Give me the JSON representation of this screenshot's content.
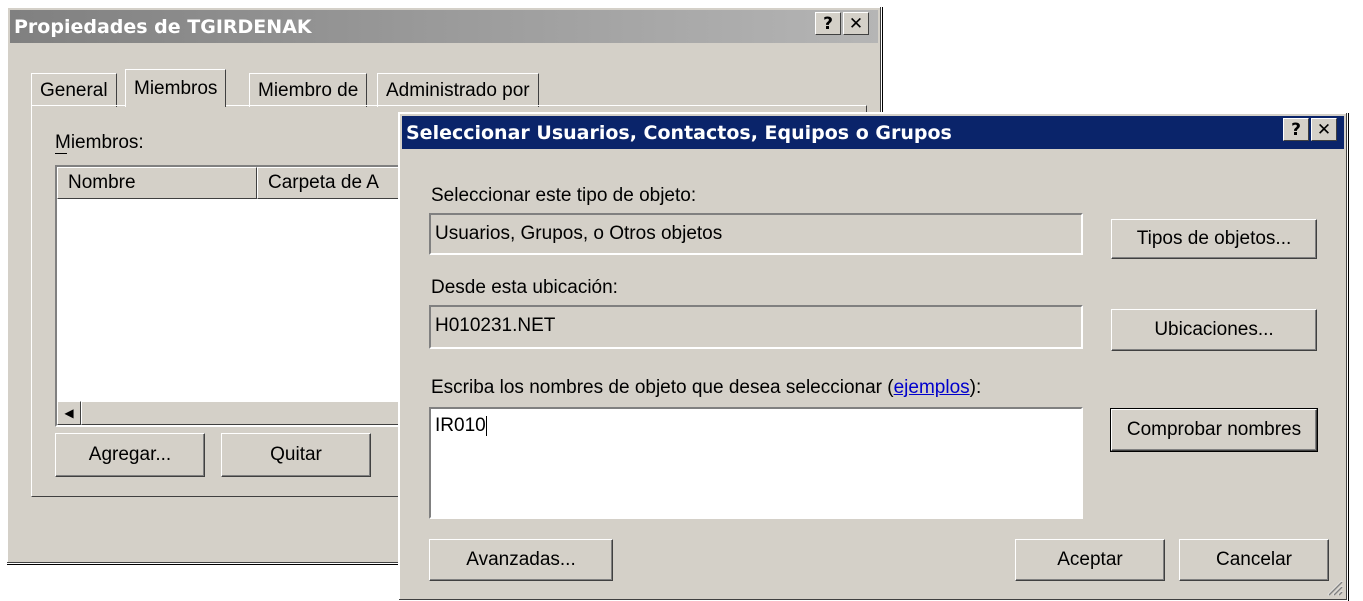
{
  "back_dialog": {
    "title": "Propiedades de TGIRDENAK",
    "help_glyph": "?",
    "close_glyph": "✕",
    "tabs": [
      "General",
      "Miembros",
      "Miembro de",
      "Administrado por"
    ],
    "members_label": "Miembros:",
    "columns": [
      "Nombre",
      "Carpeta de A"
    ],
    "scroll_left_glyph": "◀",
    "add_button": "Agregar...",
    "remove_button": "Quitar"
  },
  "front_dialog": {
    "title": "Seleccionar Usuarios, Contactos, Equipos o Grupos",
    "help_glyph": "?",
    "close_glyph": "✕",
    "object_type_label": "Seleccionar este tipo de objeto:",
    "object_type_value": "Usuarios, Grupos, o Otros objetos",
    "object_types_button": "Tipos de objetos...",
    "location_label": "Desde esta ubicación:",
    "location_value": "H010231.NET",
    "locations_button": "Ubicaciones...",
    "names_label_prefix": "Escriba los nombres de objeto que desea seleccionar (",
    "names_label_link": "ejemplos",
    "names_label_suffix": "):",
    "names_value": "IR010",
    "check_names_button": "Comprobar nombres",
    "advanced_button": "Avanzadas...",
    "ok_button": "Aceptar",
    "cancel_button": "Cancelar"
  },
  "colors": {
    "face": "#d4d0c8",
    "active_title": "#0a246a",
    "inactive_title": "#808080"
  }
}
